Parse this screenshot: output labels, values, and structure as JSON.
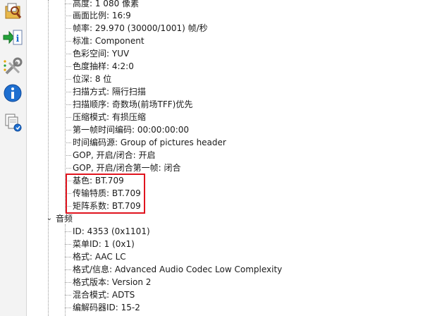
{
  "video_items": [
    "高度: 1 080 像素",
    "画面比例: 16:9",
    "帧率: 29.970 (30000/1001) 帧/秒",
    "标准: Component",
    "色彩空间: YUV",
    "色度抽样: 4:2:0",
    "位深: 8 位",
    "扫描方式: 隔行扫描",
    "扫描顺序: 奇数场(前场TFF)优先",
    "压缩模式: 有损压缩",
    "第一帧时间编码: 00:00:00:00",
    "时间编码源: Group of pictures header",
    "GOP, 开启/闭合: 开启",
    "GOP, 开启/闭合第一帧: 闭合",
    "基色: BT.709",
    "传输特质: BT.709",
    "矩阵系数: BT.709"
  ],
  "audio_section": {
    "label": "音频",
    "toggle": "⌄"
  },
  "audio_items": [
    "ID: 4353 (0x1101)",
    "菜单ID: 1 (0x1)",
    "格式: AAC LC",
    "格式/信息: Advanced Audio Codec Low Complexity",
    "格式版本: Version 2",
    "混合模式: ADTS",
    "编解码器ID: 15-2"
  ],
  "toolbar": [
    "open-file-icon",
    "export-info-icon",
    "preferences-icon",
    "about-icon",
    "sheet-view-icon"
  ],
  "colors": {
    "highlight": "#e0141e",
    "info_blue": "#1e6fd0"
  }
}
